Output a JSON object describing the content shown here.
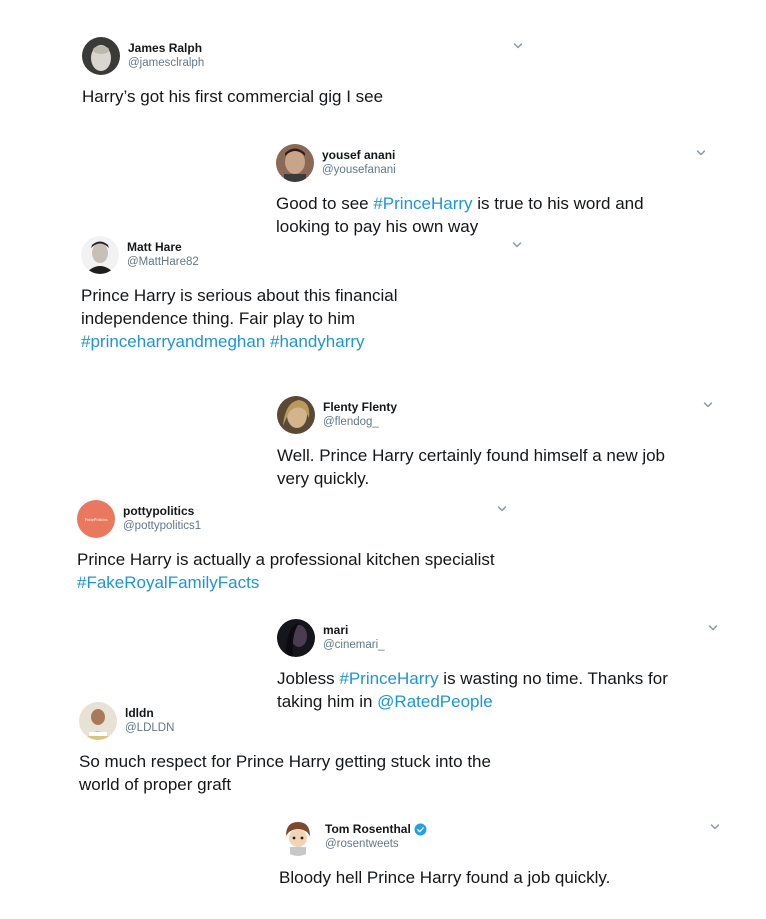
{
  "tweets": [
    {
      "name": "James Ralph",
      "handle": "@jamesclralph",
      "lines": [
        {
          "text": "Harry’s got his first commercial gig I see"
        }
      ]
    },
    {
      "name": "yousef anani",
      "handle": "@yousefanani",
      "lines": [
        {
          "pre": "Good to see ",
          "link": "#PrinceHarry",
          "post": " is true to his word and"
        },
        {
          "text": "looking to pay his own way"
        }
      ]
    },
    {
      "name": "Matt Hare",
      "handle": "@MattHare82",
      "lines": [
        {
          "text": "Prince Harry is serious about this financial"
        },
        {
          "text": "independence thing. Fair play to him"
        },
        {
          "link": "#princeharryandmeghan #handyharry"
        }
      ]
    },
    {
      "name": "Flenty Flenty",
      "handle": "@flendog_",
      "lines": [
        {
          "text": "Well. Prince Harry certainly found himself a new job"
        },
        {
          "text": "very quickly."
        }
      ]
    },
    {
      "name": "pottypolitics",
      "handle": "@pottypolitics1",
      "avatar_text": "PottyPolitics",
      "lines": [
        {
          "text": "Prince Harry is actually a professional kitchen specialist"
        },
        {
          "link": "#FakeRoyalFamilyFacts"
        }
      ]
    },
    {
      "name": "mari",
      "handle": "@cinemari_",
      "lines": [
        {
          "pre": "Jobless ",
          "link": "#PrinceHarry",
          "post": " is wasting no time. Thanks for"
        },
        {
          "pre": "taking him in ",
          "link": "@RatedPeople"
        }
      ]
    },
    {
      "name": "ldldn",
      "handle": "@LDLDN",
      "lines": [
        {
          "text": "So much respect for Prince Harry getting stuck into the"
        },
        {
          "text": "world of proper graft"
        }
      ]
    },
    {
      "name": "Tom Rosenthal",
      "handle": "@rosentweets",
      "verified": true,
      "lines": [
        {
          "text": "Bloody hell Prince Harry found a job quickly."
        }
      ]
    }
  ],
  "colors": {
    "text": "#14171a",
    "secondary": "#657786",
    "link": "#1b95e0",
    "verified": "#1da1f2",
    "chevron": "#8899a6"
  },
  "icons": {
    "menu": "chevron-down-icon",
    "verified": "verified-badge-icon"
  }
}
